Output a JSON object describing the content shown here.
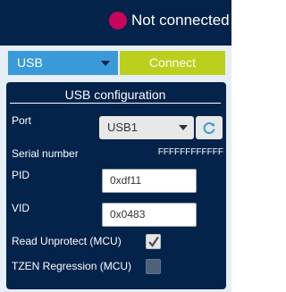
{
  "header": {
    "status_text": "Not connected",
    "status_color": "#c6065b"
  },
  "toolbar": {
    "interface_value": "USB",
    "connect_label": "Connect"
  },
  "usb_config": {
    "title": "USB configuration",
    "port_label": "Port",
    "port_value": "USB1",
    "refresh_icon": "refresh-icon",
    "serial_label": "Serial number",
    "serial_value": "FFFFFFFFFFFF",
    "pid_label": "PID",
    "pid_value": "0xdf11",
    "vid_label": "VID",
    "vid_value": "0x0483",
    "read_unprotect_label": "Read Unprotect (MCU)",
    "read_unprotect_checked": true,
    "tzen_label": "TZEN Regression (MCU)",
    "tzen_checked": false
  },
  "colors": {
    "header_bg": "#03234b",
    "panel_bg": "#03234b",
    "interface_select_bg": "#3a9ad9",
    "connect_bg": "#bccf1d"
  }
}
